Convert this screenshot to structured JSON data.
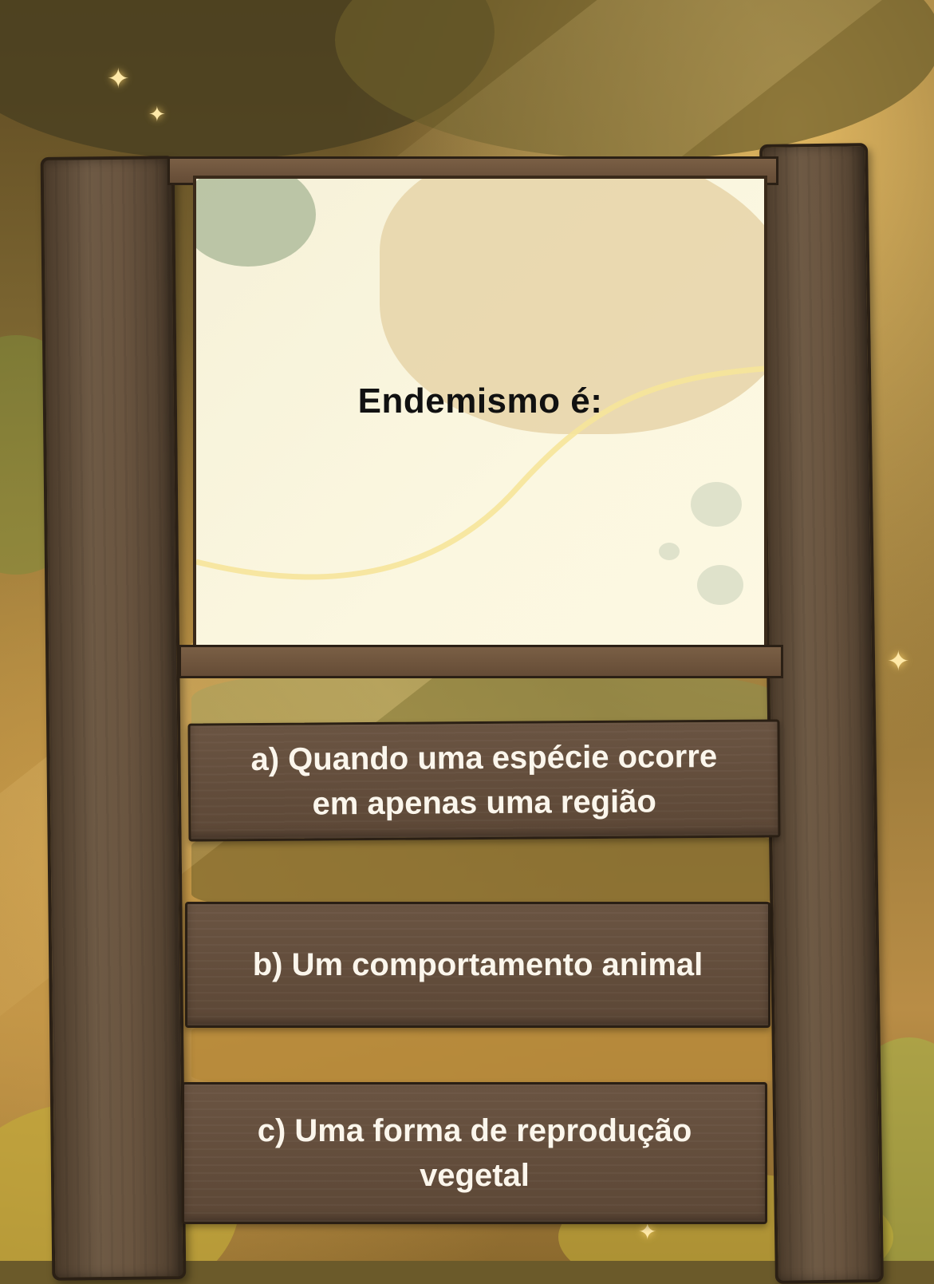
{
  "question": {
    "text": "Endemismo é:"
  },
  "answers": [
    {
      "label": "a) Quando uma espécie ocorre em apenas uma região"
    },
    {
      "label": "b) Um comportamento animal"
    },
    {
      "label": "c) Uma forma de reprodução vegetal"
    }
  ],
  "colors": {
    "board_background": "#fbf7e0",
    "plank": "#5c4736",
    "answer_text": "#fbf6ec",
    "question_text": "#111111"
  }
}
